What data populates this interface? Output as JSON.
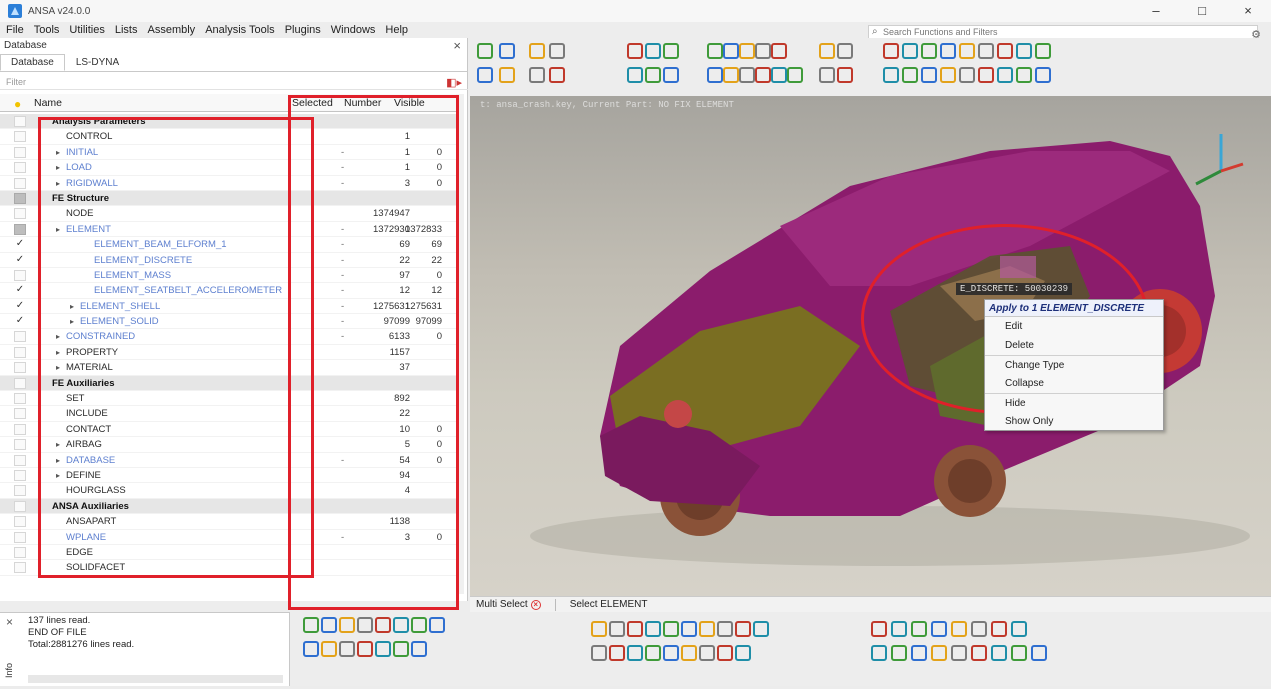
{
  "app": {
    "title": "ANSA v24.0.0",
    "controls": [
      "–",
      "□",
      "×"
    ]
  },
  "menu": [
    "File",
    "Tools",
    "Utilities",
    "Lists",
    "Assembly",
    "Analysis Tools",
    "Plugins",
    "Windows",
    "Help"
  ],
  "search": {
    "placeholder": "Search Functions and Filters"
  },
  "panel": {
    "title": "Database",
    "close": "×",
    "tabs": [
      "Database",
      "LS-DYNA"
    ],
    "filter_hint": "Filter",
    "columns": {
      "name": "Name",
      "selected": "Selected",
      "number": "Number",
      "visible": "Visible"
    }
  },
  "rows": [
    {
      "type": "group",
      "name": "Analysis Parameters",
      "check": "",
      "number": "",
      "visible": ""
    },
    {
      "type": "item",
      "name": "CONTROL",
      "indent": 1,
      "style": "plain",
      "number": "1",
      "visible": "",
      "sel": ""
    },
    {
      "type": "item",
      "name": "INITIAL",
      "indent": 1,
      "style": "blue",
      "expand": true,
      "number": "1",
      "visible": "0",
      "sel": "-"
    },
    {
      "type": "item",
      "name": "LOAD",
      "indent": 1,
      "style": "blue",
      "expand": true,
      "number": "1",
      "visible": "0",
      "sel": "-"
    },
    {
      "type": "item",
      "name": "RIGIDWALL",
      "indent": 1,
      "style": "blue",
      "expand": true,
      "number": "3",
      "visible": "0",
      "sel": "-"
    },
    {
      "type": "group",
      "name": "FE Structure",
      "check": "grey",
      "number": "",
      "visible": ""
    },
    {
      "type": "item",
      "name": "NODE",
      "indent": 1,
      "style": "plain",
      "number": "1374947",
      "visible": "",
      "sel": ""
    },
    {
      "type": "item",
      "name": "ELEMENT",
      "indent": 1,
      "style": "blue",
      "expand": true,
      "check": "grey",
      "number": "1372930",
      "visible": "1372833",
      "sel": "-"
    },
    {
      "type": "item",
      "name": "ELEMENT_BEAM_ELFORM_1",
      "indent": 3,
      "style": "blue",
      "check": "✓",
      "number": "69",
      "visible": "69",
      "sel": "-"
    },
    {
      "type": "item",
      "name": "ELEMENT_DISCRETE",
      "indent": 3,
      "style": "blue",
      "check": "✓",
      "number": "22",
      "visible": "22",
      "sel": "-"
    },
    {
      "type": "item",
      "name": "ELEMENT_MASS",
      "indent": 3,
      "style": "blue",
      "number": "97",
      "visible": "0",
      "sel": "-"
    },
    {
      "type": "item",
      "name": "ELEMENT_SEATBELT_ACCELEROMETER",
      "indent": 3,
      "style": "blue",
      "check": "✓",
      "number": "12",
      "visible": "12",
      "sel": "-"
    },
    {
      "type": "item",
      "name": "ELEMENT_SHELL",
      "indent": 2,
      "style": "blue",
      "expand": true,
      "check": "✓",
      "number": "1275631",
      "visible": "1275631",
      "sel": "-"
    },
    {
      "type": "item",
      "name": "ELEMENT_SOLID",
      "indent": 2,
      "style": "blue",
      "expand": true,
      "check": "✓",
      "number": "97099",
      "visible": "97099",
      "sel": "-"
    },
    {
      "type": "item",
      "name": "CONSTRAINED",
      "indent": 1,
      "style": "blue",
      "expand": true,
      "number": "6133",
      "visible": "0",
      "sel": "-"
    },
    {
      "type": "item",
      "name": "PROPERTY",
      "indent": 1,
      "style": "plain",
      "expand": true,
      "number": "1157",
      "visible": "",
      "sel": ""
    },
    {
      "type": "item",
      "name": "MATERIAL",
      "indent": 1,
      "style": "plain",
      "expand": true,
      "number": "37",
      "visible": "",
      "sel": ""
    },
    {
      "type": "group",
      "name": "FE Auxiliaries",
      "check": "",
      "number": "",
      "visible": ""
    },
    {
      "type": "item",
      "name": "SET",
      "indent": 1,
      "style": "plain",
      "number": "892",
      "visible": "",
      "sel": ""
    },
    {
      "type": "item",
      "name": "INCLUDE",
      "indent": 1,
      "style": "plain",
      "number": "22",
      "visible": "",
      "sel": ""
    },
    {
      "type": "item",
      "name": "CONTACT",
      "indent": 1,
      "style": "plain",
      "number": "10",
      "visible": "0",
      "sel": ""
    },
    {
      "type": "item",
      "name": "AIRBAG",
      "indent": 1,
      "style": "plain",
      "expand": true,
      "number": "5",
      "visible": "0",
      "sel": ""
    },
    {
      "type": "item",
      "name": "DATABASE",
      "indent": 1,
      "style": "blue",
      "expand": true,
      "number": "54",
      "visible": "0",
      "sel": "-"
    },
    {
      "type": "item",
      "name": "DEFINE",
      "indent": 1,
      "style": "plain",
      "expand": true,
      "number": "94",
      "visible": "",
      "sel": ""
    },
    {
      "type": "item",
      "name": "HOURGLASS",
      "indent": 1,
      "style": "plain",
      "number": "4",
      "visible": "",
      "sel": ""
    },
    {
      "type": "group",
      "name": "ANSA Auxiliaries",
      "check": "",
      "number": "",
      "visible": ""
    },
    {
      "type": "item",
      "name": "ANSAPART",
      "indent": 1,
      "style": "plain",
      "number": "1138",
      "visible": "",
      "sel": ""
    },
    {
      "type": "item",
      "name": "WPLANE",
      "indent": 1,
      "style": "blue",
      "number": "3",
      "visible": "0",
      "sel": "-"
    },
    {
      "type": "item",
      "name": "EDGE",
      "indent": 1,
      "style": "plain",
      "number": "",
      "visible": "",
      "sel": ""
    },
    {
      "type": "item",
      "name": "SOLIDFACET",
      "indent": 1,
      "style": "plain",
      "number": "",
      "visible": "",
      "sel": ""
    }
  ],
  "viewport": {
    "info_line": "t: ansa_crash.key, Current Part: NO FIX ELEMENT",
    "discrete_tag": "E_DISCRETE: 50030239"
  },
  "context_menu": {
    "header": "Apply to 1 ELEMENT_DISCRETE",
    "items": [
      "Edit",
      "Delete",
      "Change Type",
      "Collapse",
      "Hide",
      "Show Only"
    ]
  },
  "status": {
    "multi_select": "Multi Select",
    "select_mode": "Select ELEMENT"
  },
  "console": {
    "lines": [
      "137 lines read.",
      "END OF FILE",
      "Total:2881276 lines read."
    ],
    "info_tab": "Info"
  },
  "colors": {
    "annotation_red": "#e0202a",
    "body_magenta": "#8b1c6c",
    "panel_olive": "#6d6a1f",
    "link_blue": "#5d7fcf"
  }
}
